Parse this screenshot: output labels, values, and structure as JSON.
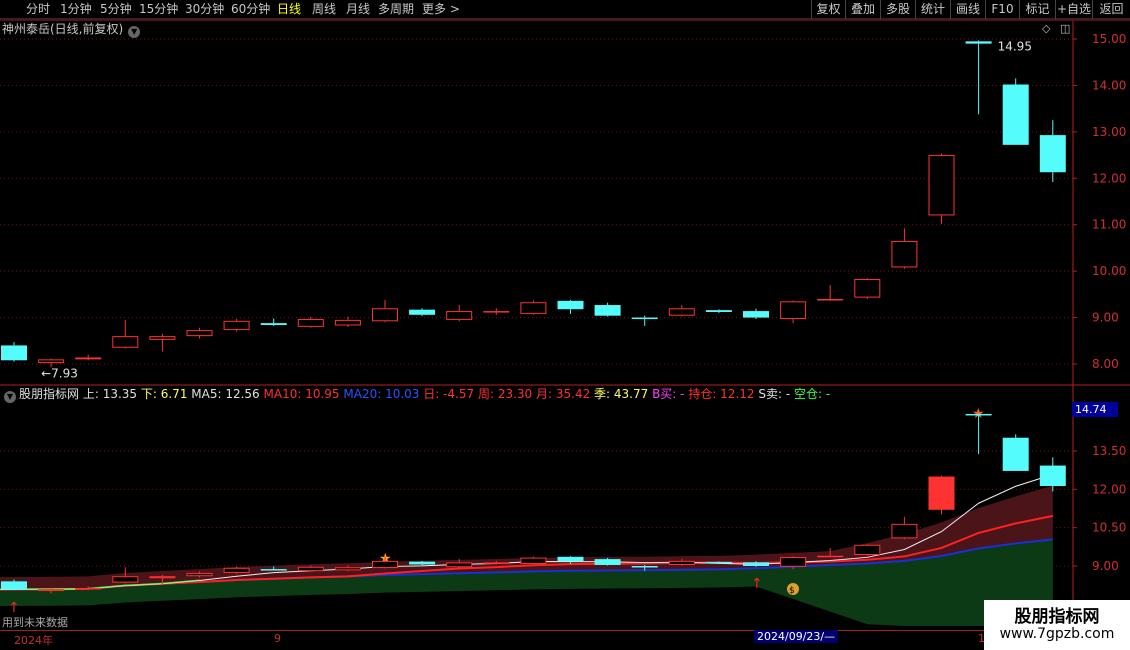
{
  "periods": [
    {
      "label": "分时",
      "active": false
    },
    {
      "label": "1分钟",
      "active": false
    },
    {
      "label": "5分钟",
      "active": false
    },
    {
      "label": "15分钟",
      "active": false
    },
    {
      "label": "30分钟",
      "active": false
    },
    {
      "label": "60分钟",
      "active": false
    },
    {
      "label": "日线",
      "active": true
    },
    {
      "label": "周线",
      "active": false
    },
    {
      "label": "月线",
      "active": false
    },
    {
      "label": "多周期",
      "active": false
    },
    {
      "label": "更多 >",
      "active": false
    }
  ],
  "toolbar": [
    "复权",
    "叠加",
    "多股",
    "统计",
    "画线",
    "F10",
    "标记",
    "+自选",
    "返回"
  ],
  "main_title": "神州泰岳(日线,前复权)",
  "main_axis_labels": [
    "15.00",
    "14.00",
    "13.00",
    "12.00",
    "11.00",
    "10.00",
    "9.00",
    "8.00"
  ],
  "high_label": "14.95",
  "low_label": "7.93",
  "indicator": {
    "name": "股朋指标网",
    "fields": [
      {
        "text": "上: 13.35",
        "color": "#e0e0e0"
      },
      {
        "text": "下: 6.71",
        "color": "#ffff60"
      },
      {
        "text": "MA5: 12.56",
        "color": "#e0e0e0"
      },
      {
        "text": "MA10: 10.95",
        "color": "#ff3030"
      },
      {
        "text": "MA20: 10.03",
        "color": "#3050ff"
      },
      {
        "text": "日: -4.57",
        "color": "#ff3030"
      },
      {
        "text": "周: 23.30",
        "color": "#ff3030"
      },
      {
        "text": "月: 35.42",
        "color": "#ff3030"
      },
      {
        "text": "季: 43.77",
        "color": "#ffff60"
      },
      {
        "text": "B买: -",
        "color": "#ff40ff"
      },
      {
        "text": "持仓: 12.12",
        "color": "#ff3030"
      },
      {
        "text": "S卖: -",
        "color": "#e0e0e0"
      },
      {
        "text": "空仓: -",
        "color": "#40ff40"
      }
    ],
    "axis_labels": [
      "13.50",
      "12.00",
      "10.50",
      "9.00"
    ],
    "price_tag": "14.74"
  },
  "future_note": "用到未来数据",
  "date_axis": {
    "labels": [
      "2024年",
      "9",
      "1"
    ],
    "cursor": "2024/09/23/—"
  },
  "watermark": {
    "title": "股朋指标网",
    "url": "www.7gpzb.com"
  },
  "colors": {
    "up": "#ff3232",
    "down": "#54fcfc",
    "bg": "#000000",
    "grid": "#7a1010"
  },
  "chart_data": {
    "type": "candlestick",
    "title": "神州泰岳(日线,前复权)",
    "ylim": [
      7.6,
      15.2
    ],
    "candles": [
      {
        "o": 8.4,
        "c": 8.08,
        "h": 8.47,
        "l": 8.05
      },
      {
        "o": 8.02,
        "c": 8.1,
        "h": 8.12,
        "l": 7.93
      },
      {
        "o": 8.1,
        "c": 8.14,
        "h": 8.2,
        "l": 8.08
      },
      {
        "o": 8.35,
        "c": 8.6,
        "h": 8.95,
        "l": 8.33
      },
      {
        "o": 8.52,
        "c": 8.6,
        "h": 8.65,
        "l": 8.27
      },
      {
        "o": 8.6,
        "c": 8.73,
        "h": 8.78,
        "l": 8.55
      },
      {
        "o": 8.73,
        "c": 8.93,
        "h": 8.97,
        "l": 8.7
      },
      {
        "o": 8.88,
        "c": 8.84,
        "h": 8.98,
        "l": 8.82
      },
      {
        "o": 8.8,
        "c": 8.97,
        "h": 9.02,
        "l": 8.78
      },
      {
        "o": 8.83,
        "c": 8.95,
        "h": 9.02,
        "l": 8.8
      },
      {
        "o": 8.92,
        "c": 9.2,
        "h": 9.38,
        "l": 8.9
      },
      {
        "o": 9.17,
        "c": 9.06,
        "h": 9.2,
        "l": 9.03
      },
      {
        "o": 8.95,
        "c": 9.14,
        "h": 9.27,
        "l": 8.92
      },
      {
        "o": 9.12,
        "c": 9.14,
        "h": 9.2,
        "l": 9.06
      },
      {
        "o": 9.08,
        "c": 9.33,
        "h": 9.37,
        "l": 9.06
      },
      {
        "o": 9.36,
        "c": 9.18,
        "h": 9.38,
        "l": 9.08
      },
      {
        "o": 9.27,
        "c": 9.04,
        "h": 9.32,
        "l": 9.02
      },
      {
        "o": 9.0,
        "c": 8.98,
        "h": 9.04,
        "l": 8.82
      },
      {
        "o": 9.04,
        "c": 9.2,
        "h": 9.27,
        "l": 9.02
      },
      {
        "o": 9.16,
        "c": 9.12,
        "h": 9.18,
        "l": 9.1
      },
      {
        "o": 9.14,
        "c": 9.0,
        "h": 9.19,
        "l": 8.97
      },
      {
        "o": 8.97,
        "c": 9.35,
        "h": 9.37,
        "l": 8.88
      },
      {
        "o": 9.38,
        "c": 9.4,
        "h": 9.7,
        "l": 9.36
      },
      {
        "o": 9.43,
        "c": 9.83,
        "h": 9.85,
        "l": 9.4
      },
      {
        "o": 10.08,
        "c": 10.65,
        "h": 10.92,
        "l": 10.05
      },
      {
        "o": 11.2,
        "c": 12.5,
        "h": 12.53,
        "l": 11.02
      },
      {
        "o": 14.95,
        "c": 14.9,
        "h": 14.97,
        "l": 13.38
      },
      {
        "o": 14.02,
        "c": 12.72,
        "h": 14.15,
        "l": 12.72
      },
      {
        "o": 12.93,
        "c": 12.13,
        "h": 13.25,
        "l": 11.92
      }
    ]
  }
}
